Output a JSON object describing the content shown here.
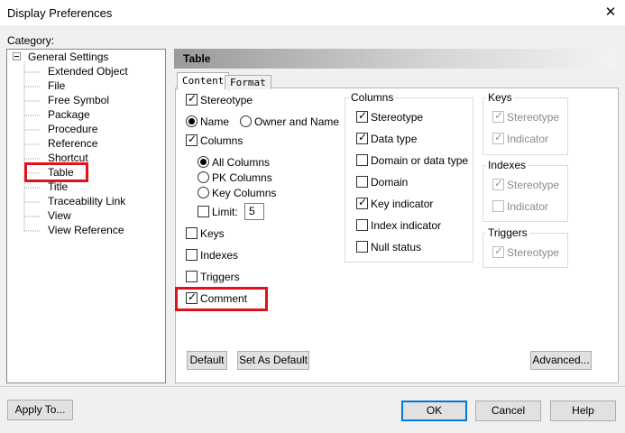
{
  "window": {
    "title": "Display Preferences",
    "close_glyph": "✕"
  },
  "category_label": "Category:",
  "tree": {
    "root": "General Settings",
    "items": [
      "Extended Object",
      "File",
      "Free Symbol",
      "Package",
      "Procedure",
      "Reference",
      "Shortcut",
      "Table",
      "Title",
      "Traceability Link",
      "View",
      "View Reference"
    ],
    "selected": "Table"
  },
  "panel": {
    "title": "Table"
  },
  "tabs": [
    {
      "label": "Content",
      "active": true
    },
    {
      "label": "Format",
      "active": false
    }
  ],
  "content": {
    "stereotype": {
      "label": "Stereotype",
      "checked": true
    },
    "name_radio": {
      "label": "Name",
      "selected": true
    },
    "owner_name_radio": {
      "label": "Owner and Name",
      "selected": false
    },
    "columns": {
      "label": "Columns",
      "checked": true
    },
    "all_columns": {
      "label": "All Columns",
      "selected": true
    },
    "pk_columns": {
      "label": "PK Columns",
      "selected": false
    },
    "key_columns": {
      "label": "Key Columns",
      "selected": false
    },
    "limit": {
      "label": "Limit:",
      "checked": false,
      "value": "5"
    },
    "keys": {
      "label": "Keys",
      "checked": false
    },
    "indexes": {
      "label": "Indexes",
      "checked": false
    },
    "triggers": {
      "label": "Triggers",
      "checked": false
    },
    "comment": {
      "label": "Comment",
      "checked": true
    }
  },
  "columns_group": {
    "title": "Columns",
    "items": [
      {
        "label": "Stereotype",
        "checked": true
      },
      {
        "label": "Data type",
        "checked": true
      },
      {
        "label": "Domain or data type",
        "checked": false
      },
      {
        "label": "Domain",
        "checked": false
      },
      {
        "label": "Key indicator",
        "checked": true
      },
      {
        "label": "Index indicator",
        "checked": false
      },
      {
        "label": "Null status",
        "checked": false
      }
    ]
  },
  "keys_group": {
    "title": "Keys",
    "items": [
      {
        "label": "Stereotype",
        "checked": true
      },
      {
        "label": "Indicator",
        "checked": true
      }
    ]
  },
  "indexes_group": {
    "title": "Indexes",
    "items": [
      {
        "label": "Stereotype",
        "checked": true
      },
      {
        "label": "Indicator",
        "checked": false
      }
    ]
  },
  "triggers_group": {
    "title": "Triggers",
    "items": [
      {
        "label": "Stereotype",
        "checked": true
      }
    ]
  },
  "panel_buttons": {
    "default": "Default",
    "set_as_default": "Set As Default",
    "advanced": "Advanced..."
  },
  "footer_buttons": {
    "apply_to": "Apply To...",
    "ok": "OK",
    "cancel": "Cancel",
    "help": "Help"
  },
  "colors": {
    "highlight": "#e0121b",
    "primary_border": "#0078d7"
  }
}
